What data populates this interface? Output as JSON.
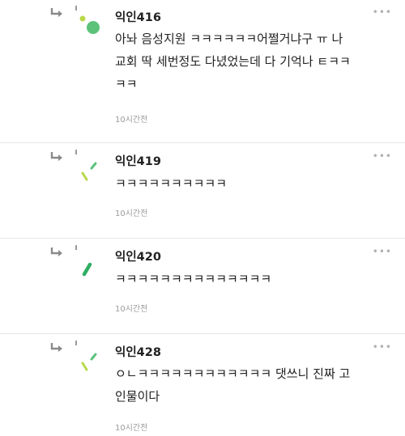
{
  "comments": [
    {
      "author": "익인416",
      "text": "아놔 음성지원 ㅋㅋㅋㅋㅋㅋ어쩔거냐구 ㅠ 나\n교회 딱 세번정도 다녔었는데 다 기억나 ㅌㅋㅋ\nㅋㅋ",
      "time": "10시간전",
      "more": "•••"
    },
    {
      "author": "익인419",
      "text": "ㅋㅋㅋㅋㅋㅋㅋㅋㅋㅋ",
      "time": "10시간전",
      "more": "•••"
    },
    {
      "author": "익인420",
      "text": "ㅋㅋㅋㅋㅋㅋㅋㅋㅋㅋㅋㅋㅋㅋ",
      "time": "10시간전",
      "more": "•••"
    },
    {
      "author": "익인428",
      "text": "ㅇㄴㅋㅋㅋㅋㅋㅋㅋㅋㅋㅋㅋㅋ 댓쓰니 진짜 고\n인물이다",
      "time": "10시간전",
      "more": "•••"
    }
  ],
  "colors": {
    "avatar_green": "#5cc27a",
    "avatar_lime": "#b7d94a",
    "avatar_dark_green": "#2fae62",
    "reply_arrow": "#8a8a8a"
  },
  "icons": [
    "reply-arrow-icon",
    "avatar-icon",
    "more-options-icon"
  ]
}
